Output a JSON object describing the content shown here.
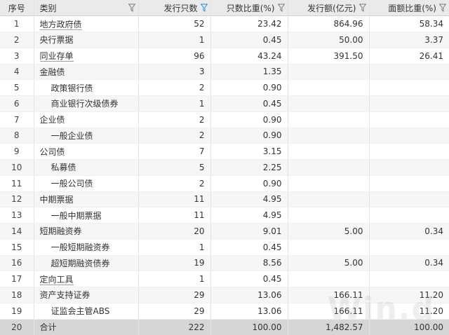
{
  "columns": [
    {
      "label": "序号",
      "filter": false,
      "filter_active": false
    },
    {
      "label": "类别",
      "filter": true,
      "filter_active": false
    },
    {
      "label": "发行只数",
      "filter": true,
      "filter_active": true
    },
    {
      "label": "只数比重(%)",
      "filter": true,
      "filter_active": false
    },
    {
      "label": "发行额(亿元)",
      "filter": true,
      "filter_active": false
    },
    {
      "label": "面额比重(%)",
      "filter": true,
      "filter_active": false
    }
  ],
  "rows": [
    {
      "idx": "1",
      "category": "地方政府债",
      "level": 0,
      "link": true,
      "count": "52",
      "count_pct": "23.42",
      "amount": "864.96",
      "amount_pct": "58.34"
    },
    {
      "idx": "2",
      "category": "央行票据",
      "level": 0,
      "link": false,
      "count": "1",
      "count_pct": "0.45",
      "amount": "50.00",
      "amount_pct": "3.37"
    },
    {
      "idx": "3",
      "category": "同业存单",
      "level": 0,
      "link": true,
      "count": "96",
      "count_pct": "43.24",
      "amount": "391.50",
      "amount_pct": "26.41"
    },
    {
      "idx": "4",
      "category": "金融债",
      "level": 0,
      "link": false,
      "count": "3",
      "count_pct": "1.35",
      "amount": "",
      "amount_pct": ""
    },
    {
      "idx": "5",
      "category": "政策银行债",
      "level": 1,
      "link": false,
      "count": "2",
      "count_pct": "0.90",
      "amount": "",
      "amount_pct": ""
    },
    {
      "idx": "6",
      "category": "商业银行次级债券",
      "level": 1,
      "link": false,
      "count": "1",
      "count_pct": "0.45",
      "amount": "",
      "amount_pct": ""
    },
    {
      "idx": "7",
      "category": "企业债",
      "level": 0,
      "link": false,
      "count": "2",
      "count_pct": "0.90",
      "amount": "",
      "amount_pct": ""
    },
    {
      "idx": "8",
      "category": "一般企业债",
      "level": 1,
      "link": false,
      "count": "2",
      "count_pct": "0.90",
      "amount": "",
      "amount_pct": ""
    },
    {
      "idx": "9",
      "category": "公司债",
      "level": 0,
      "link": false,
      "count": "7",
      "count_pct": "3.15",
      "amount": "",
      "amount_pct": ""
    },
    {
      "idx": "10",
      "category": "私募债",
      "level": 1,
      "link": false,
      "count": "5",
      "count_pct": "2.25",
      "amount": "",
      "amount_pct": ""
    },
    {
      "idx": "11",
      "category": "一般公司债",
      "level": 1,
      "link": false,
      "count": "2",
      "count_pct": "0.90",
      "amount": "",
      "amount_pct": ""
    },
    {
      "idx": "12",
      "category": "中期票据",
      "level": 0,
      "link": false,
      "count": "11",
      "count_pct": "4.95",
      "amount": "",
      "amount_pct": ""
    },
    {
      "idx": "13",
      "category": "一般中期票据",
      "level": 1,
      "link": false,
      "count": "11",
      "count_pct": "4.95",
      "amount": "",
      "amount_pct": ""
    },
    {
      "idx": "14",
      "category": "短期融资券",
      "level": 0,
      "link": false,
      "count": "20",
      "count_pct": "9.01",
      "amount": "5.00",
      "amount_pct": "0.34"
    },
    {
      "idx": "15",
      "category": "一般短期融资券",
      "level": 1,
      "link": false,
      "count": "1",
      "count_pct": "0.45",
      "amount": "",
      "amount_pct": ""
    },
    {
      "idx": "16",
      "category": "超短期融资债券",
      "level": 1,
      "link": false,
      "count": "19",
      "count_pct": "8.56",
      "amount": "5.00",
      "amount_pct": "0.34"
    },
    {
      "idx": "17",
      "category": "定向工具",
      "level": 0,
      "link": true,
      "count": "1",
      "count_pct": "0.45",
      "amount": "",
      "amount_pct": ""
    },
    {
      "idx": "18",
      "category": "资产支持证券",
      "level": 0,
      "link": false,
      "count": "29",
      "count_pct": "13.06",
      "amount": "166.11",
      "amount_pct": "11.20"
    },
    {
      "idx": "19",
      "category": "证监会主管ABS",
      "level": 1,
      "link": false,
      "count": "29",
      "count_pct": "13.06",
      "amount": "166.11",
      "amount_pct": "11.20"
    },
    {
      "idx": "20",
      "category": "合计",
      "level": 0,
      "link": false,
      "count": "222",
      "count_pct": "100.00",
      "amount": "1,482.57",
      "amount_pct": "100.00",
      "total": true
    }
  ],
  "watermark": "Win.d",
  "colors": {
    "filter_active": "#2a8ad4",
    "filter_inactive": "#7a7a7a",
    "header_bg": "#eaeaea",
    "total_bg": "#d6d6d6"
  }
}
